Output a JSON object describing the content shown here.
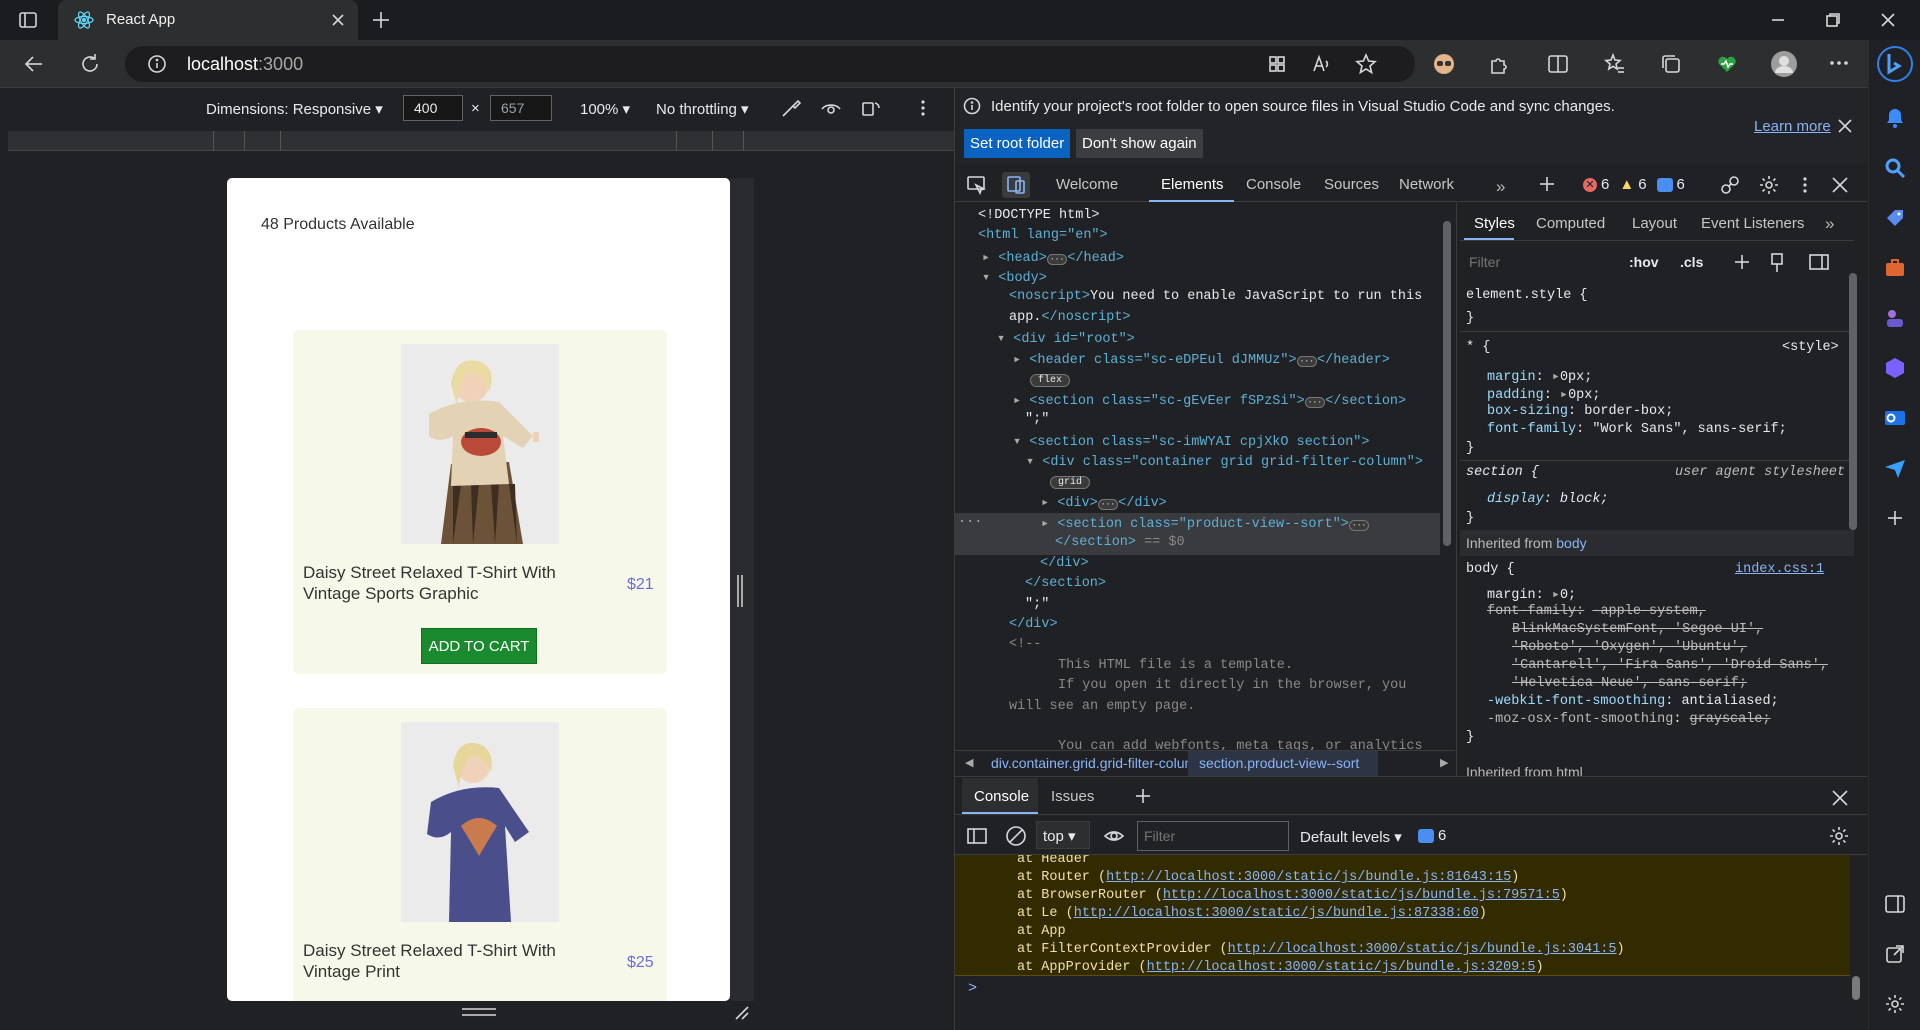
{
  "browser": {
    "tab_title": "React App",
    "url_host": "localhost",
    "url_port": ":3000",
    "accent": "#0b63c1"
  },
  "device_toolbar": {
    "dimensions_label": "Dimensions: Responsive",
    "width_value": "400",
    "times": "×",
    "height_value": "657",
    "zoom": "100%",
    "throttling": "No throttling"
  },
  "page": {
    "products_count_label": "48 Products Available",
    "add_to_cart_label": "ADD TO CART",
    "products": [
      {
        "name_line1": "Daisy Street Relaxed T-Shirt With",
        "name_line2": "Vintage Sports Graphic",
        "price": "$21"
      },
      {
        "name_line1": "Daisy Street Relaxed T-Shirt With",
        "name_line2": "Vintage Print",
        "price": "$25"
      }
    ]
  },
  "devtools": {
    "info_message": "Identify your project's root folder to open source files in Visual Studio Code and sync changes.",
    "set_root_folder": "Set root folder",
    "dont_show_again": "Don't show again",
    "learn_more": "Learn more",
    "tabs": [
      "Welcome",
      "Elements",
      "Console",
      "Sources",
      "Network"
    ],
    "active_tab": "Elements",
    "error_count": "6",
    "warning_count": "6",
    "info_count": "6",
    "styles_tabs": [
      "Styles",
      "Computed",
      "Layout",
      "Event Listeners"
    ],
    "filter_placeholder": "Filter",
    "hov": ":hov",
    "cls": ".cls",
    "breadcrumb": [
      "div.container.grid.grid-filter-column",
      "section.product-view--sort"
    ],
    "elements_lines": [
      "<!DOCTYPE html>",
      "<html lang=\"en\">",
      "<head>",
      "</head>",
      "<body>",
      "<noscript>",
      "You need to enable JavaScript to run this",
      "app.",
      "</noscript>",
      "<div id=\"root\">",
      "<header class=\"sc-eDPEul dJMMUz\">",
      "</header>",
      "flex",
      "<section class=\"sc-gEvEer fSPzSi\">",
      "</section>",
      "\";\"",
      "<section class=\"sc-imWYAI cpjXkO section\">",
      "<div class=\"container grid grid-filter-column\">",
      "grid",
      "<div>",
      "</div>",
      "<section class=\"product-view--sort\">",
      "</section>",
      "== $0",
      "</div>",
      "</section>",
      "\";\"",
      "</div>",
      "<!--",
      "This HTML file is a template.",
      "If you open it directly in the browser, you",
      "will see an empty page.",
      "You can add webfonts, meta tags, or analytics"
    ],
    "styles_lines": [
      "element.style {",
      "}",
      "* {",
      "<style>",
      "margin",
      "0px;",
      "padding",
      "0px;",
      "box-sizing",
      "border-box;",
      "font-family",
      "\"Work Sans\", sans-serif;",
      "}",
      "section {",
      "user agent stylesheet",
      "display",
      "block;",
      "}",
      "Inherited from",
      "body",
      "body {",
      "index.css:1",
      "margin",
      "0;",
      "font-family",
      "-apple-system,",
      "BlinkMacSystemFont, 'Segoe UI',",
      "'Roboto', 'Oxygen', 'Ubuntu',",
      "'Cantarell', 'Fira Sans', 'Droid Sans',",
      "'Helvetica Neue', sans-serif;",
      "-webkit-font-smoothing",
      "antialiased;",
      "-moz-osx-font-smoothing",
      "grayscale;",
      "}",
      "Inherited from html"
    ],
    "drawer_tabs": [
      "Console",
      "Issues"
    ],
    "context": "top",
    "console_filter_placeholder": "Filter",
    "default_levels": "Default levels",
    "console_badge": "6",
    "console_lines": [
      {
        "pre": "at Header",
        "link": ""
      },
      {
        "pre": "at Router (",
        "link": "http://localhost:3000/static/js/bundle.js:81643:15"
      },
      {
        "pre": "at BrowserRouter (",
        "link": "http://localhost:3000/static/js/bundle.js:79571:5"
      },
      {
        "pre": "at Le (",
        "link": "http://localhost:3000/static/js/bundle.js:87338:60"
      },
      {
        "pre": "at App",
        "link": ""
      },
      {
        "pre": "at FilterContextProvider (",
        "link": "http://localhost:3000/static/js/bundle.js:3041:5"
      },
      {
        "pre": "at AppProvider (",
        "link": "http://localhost:3000/static/js/bundle.js:3209:5"
      }
    ],
    "close_paren": ")",
    "prompt": ">"
  }
}
